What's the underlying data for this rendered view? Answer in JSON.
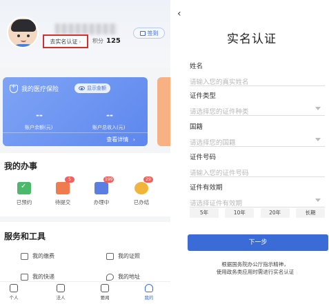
{
  "profile": {
    "verify_link": "去实名认证",
    "verify_chevron": "›",
    "points_label": "积分",
    "points_value": "125",
    "signin_label": "签到"
  },
  "insurance": {
    "title": "我的医疗保险",
    "show_amount": "显示金额",
    "balance_value": "--",
    "balance_label": "账户余额(元)",
    "income_value": "--",
    "income_label": "账户总收入(元)",
    "detail_label": "查看详情",
    "detail_chevron": "›"
  },
  "affairs": {
    "title": "我的办事",
    "items": [
      {
        "label": "已预约",
        "badge": "",
        "icon": "calendar-check-icon",
        "color": "#4cb86b"
      },
      {
        "label": "待提交",
        "badge": "5",
        "icon": "inbox-icon",
        "color": "#ef7b4f"
      },
      {
        "label": "办理中",
        "badge": "199",
        "icon": "pin-icon",
        "color": "#5b7fe0"
      },
      {
        "label": "已办结",
        "badge": "29",
        "icon": "done-icon",
        "color": "#f2b53b"
      }
    ]
  },
  "services": {
    "title": "服务和工具",
    "items": [
      {
        "label": "我的缴费",
        "icon": "wallet-icon"
      },
      {
        "label": "我的证照",
        "icon": "license-icon"
      },
      {
        "label": "我的快递",
        "icon": "parcel-icon"
      },
      {
        "label": "我的地址",
        "icon": "location-icon"
      }
    ]
  },
  "tabbar": {
    "items": [
      {
        "label": "个人",
        "icon": "person-icon"
      },
      {
        "label": "法人",
        "icon": "enterprise-icon"
      },
      {
        "label": "要闻",
        "icon": "news-icon"
      },
      {
        "label": "我的",
        "icon": "my-icon",
        "active": true
      }
    ]
  },
  "verify_form": {
    "back": "‹",
    "title": "实名认证",
    "name_label": "姓名",
    "name_placeholder": "请输入您的真实姓名",
    "idtype_label": "证件类型",
    "idtype_placeholder": "请选择您的证件种类",
    "nationality_label": "国籍",
    "nationality_placeholder": "请选择您的国籍",
    "idnumber_label": "证件号码",
    "idnumber_placeholder": "请输入您的证件号码",
    "validity_label": "证件有效期",
    "validity_placeholder": "请选择证件有效期",
    "year_options": [
      "5年",
      "10年",
      "20年",
      "长期"
    ],
    "next_button": "下一步",
    "note_line1": "根据国务院办公厅指示精神，",
    "note_line2": "使用政务类应用时需进行实名认证"
  },
  "colors": {
    "accent": "#3b6bd6",
    "highlight_border": "#d32f2f",
    "card_blue": "#6b91f1"
  }
}
